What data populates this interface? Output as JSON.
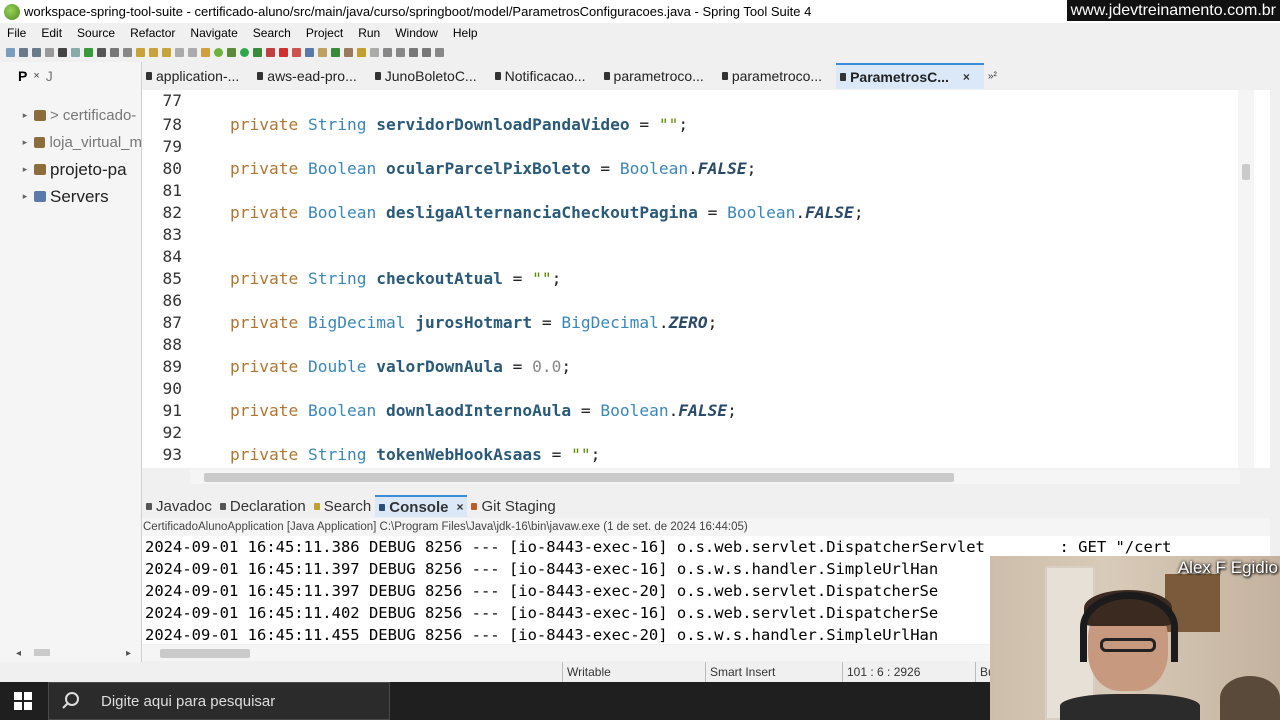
{
  "window": {
    "title": "workspace-spring-tool-suite - certificado-aluno/src/main/java/curso/springboot/model/ParametrosConfiguracoes.java - Spring Tool Suite 4",
    "watermark": "www.jdevtreinamento.com.br"
  },
  "menu": [
    "File",
    "Edit",
    "Source",
    "Refactor",
    "Navigate",
    "Search",
    "Project",
    "Run",
    "Window",
    "Help"
  ],
  "left_panel": {
    "tab_label": "P",
    "tab2_label": "J",
    "close": "×",
    "tree": [
      {
        "label": "> certificado-",
        "arrow": "▸"
      },
      {
        "label": "loja_virtual_m",
        "arrow": "▸"
      },
      {
        "label": "projeto-pa",
        "arrow": "▸"
      },
      {
        "label": "Servers",
        "arrow": "▸"
      }
    ]
  },
  "editor": {
    "tabs": [
      {
        "label": "application-..."
      },
      {
        "label": "aws-ead-pro..."
      },
      {
        "label": "JunoBoletoC..."
      },
      {
        "label": "Notificacao..."
      },
      {
        "label": "parametroco..."
      },
      {
        "label": "parametroco..."
      },
      {
        "label": "ParametrosC...",
        "active": true
      }
    ],
    "overflow": "»²",
    "close": "×",
    "line_numbers": [
      "77",
      "78",
      "79",
      "80",
      "81",
      "82",
      "83",
      "84",
      "85",
      "86",
      "87",
      "88",
      "89",
      "90",
      "91",
      "92",
      "93"
    ],
    "code": {
      "l78": {
        "kw": "private",
        "type": "String",
        "name": "servidorDownloadPandaVideo",
        "rest": " = ",
        "val": "\"\"",
        "end": ";"
      },
      "l80": {
        "kw": "private",
        "type": "Boolean",
        "name": "ocularParcelPixBoleto",
        "rest": " = ",
        "cls": "Boolean",
        "dot": ".",
        "const": "FALSE",
        "end": ";"
      },
      "l82": {
        "kw": "private",
        "type": "Boolean",
        "name": "desligaAlternanciaCheckoutPagina",
        "rest": " = ",
        "cls": "Boolean",
        "dot": ".",
        "const": "FALSE",
        "end": ";"
      },
      "l85": {
        "kw": "private",
        "type": "String",
        "name": "checkoutAtual",
        "rest": " = ",
        "val": "\"\"",
        "end": ";"
      },
      "l87": {
        "kw": "private",
        "type": "BigDecimal",
        "name": "jurosHotmart",
        "rest": " = ",
        "cls": "BigDecimal",
        "dot": ".",
        "const": "ZERO",
        "end": ";"
      },
      "l89": {
        "kw": "private",
        "type": "Double",
        "name": "valorDownAula",
        "rest": " = ",
        "val": "0.0",
        "end": ";"
      },
      "l91": {
        "kw": "private",
        "type": "Boolean",
        "name": "downlaodInternoAula",
        "rest": " = ",
        "cls": "Boolean",
        "dot": ".",
        "const": "FALSE",
        "end": ";"
      },
      "l93": {
        "kw": "private",
        "type": "String",
        "name": "tokenWebHookAsaas",
        "rest": " = ",
        "val": "\"\"",
        "end": ";"
      }
    }
  },
  "console": {
    "tabs": [
      {
        "label": "Javadoc"
      },
      {
        "label": "Declaration"
      },
      {
        "label": "Search"
      },
      {
        "label": "Console",
        "active": true
      },
      {
        "label": "Git Staging"
      }
    ],
    "close": "×",
    "header": "CertificadoAlunoApplication [Java Application] C:\\Program Files\\Java\\jdk-16\\bin\\javaw.exe  (1 de set. de 2024 16:44:05)",
    "lines": [
      "2024-09-01 16:45:11.386 DEBUG 8256 --- [io-8443-exec-16] o.s.web.servlet.DispatcherServlet        : GET \"/cert",
      "2024-09-01 16:45:11.397 DEBUG 8256 --- [io-8443-exec-16] o.s.w.s.handler.SimpleUrlHan",
      "2024-09-01 16:45:11.397 DEBUG 8256 --- [io-8443-exec-20] o.s.web.servlet.DispatcherSe",
      "2024-09-01 16:45:11.402 DEBUG 8256 --- [io-8443-exec-16] o.s.web.servlet.DispatcherSe",
      "2024-09-01 16:45:11.455 DEBUG 8256 --- [io-8443-exec-20] o.s.w.s.handler.SimpleUrlHan"
    ]
  },
  "statusbar": {
    "writable": "Writable",
    "insert_mode": "Smart Insert",
    "position": "101 : 6 : 2926",
    "extra": "Bu"
  },
  "taskbar": {
    "search_placeholder": "Digite aqui para pesquisar"
  },
  "webcam": {
    "name": "Alex F Egidio"
  },
  "colors": {
    "keyword": "#cc7832",
    "type": "#3a87b8",
    "active_tab": "#dbe8f7",
    "accent": "#3c8bd6"
  }
}
